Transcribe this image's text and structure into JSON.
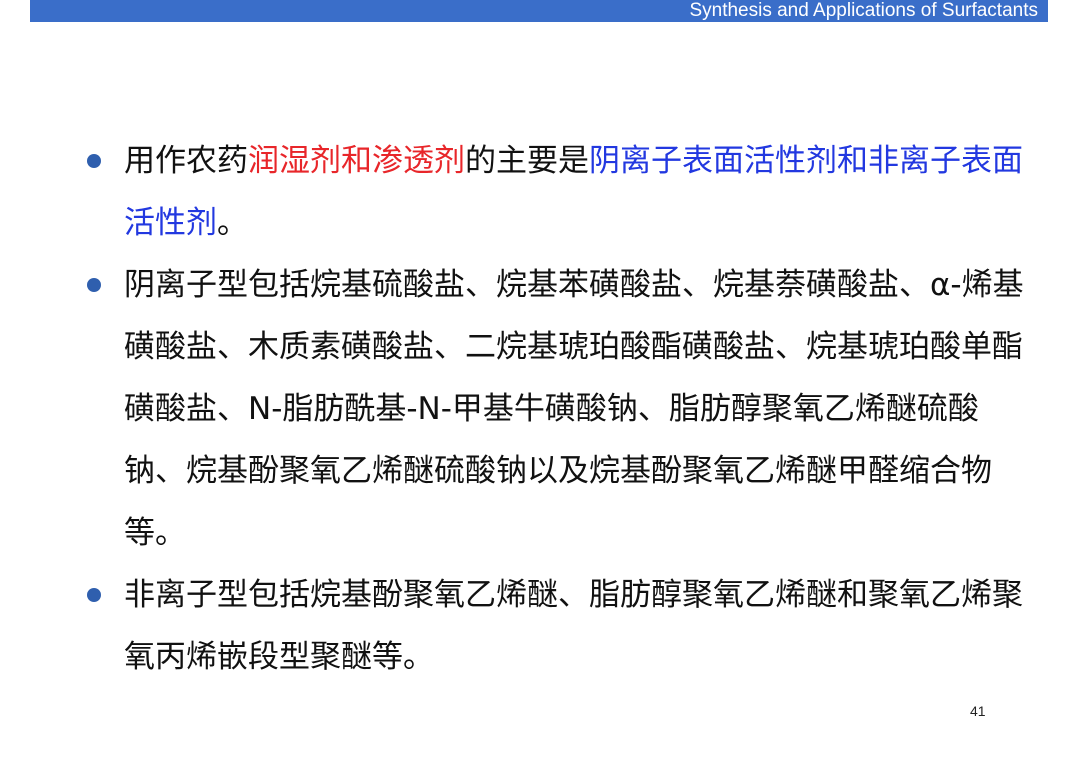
{
  "header": {
    "title": "Synthesis and Applications of Surfactants",
    "background_color": "#3a6ec9"
  },
  "bullets": [
    {
      "parts": [
        {
          "text": "用作农药",
          "color": "default"
        },
        {
          "text": "润湿剂和渗透剂",
          "color": "#e8262a"
        },
        {
          "text": "的主要是",
          "color": "default"
        },
        {
          "text": "阴离子表面活性剂和非离子表面活性剂",
          "color": "#2238e0"
        },
        {
          "text": "。",
          "color": "default"
        }
      ]
    },
    {
      "text": "阴离子型包括烷基硫酸盐、烷基苯磺酸盐、烷基萘磺酸盐、α-烯基磺酸盐、木质素磺酸盐、二烷基琥珀酸酯磺酸盐、烷基琥珀酸单酯磺酸盐、N-脂肪酰基-N-甲基牛磺酸钠、脂肪醇聚氧乙烯醚硫酸钠、烷基酚聚氧乙烯醚硫酸钠以及烷基酚聚氧乙烯醚甲醛缩合物等。"
    },
    {
      "text": "非离子型包括烷基酚聚氧乙烯醚、脂肪醇聚氧乙烯醚和聚氧乙烯聚氧丙烯嵌段型聚醚等。"
    }
  ],
  "page_number": "41",
  "bullet_color": "#2f5fae"
}
